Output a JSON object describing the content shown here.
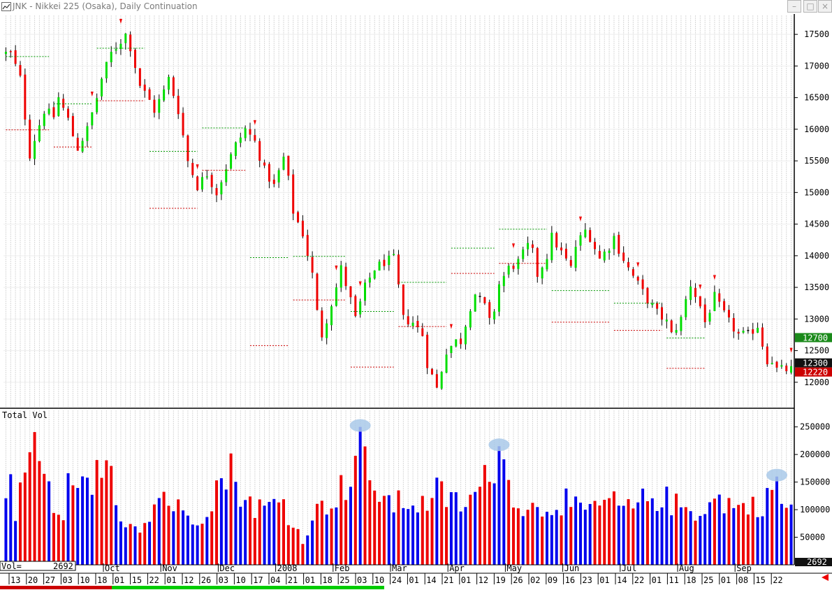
{
  "window": {
    "title": "JNK - Nikkei 225 (Osaka), Daily Continuation",
    "minimize_label": "–",
    "maximize_label": "□",
    "close_label": "×",
    "icon": "chart-window-icon"
  },
  "volume_panel": {
    "title": "Total Vol",
    "readout_label": "Vol=",
    "readout_value": "2692"
  },
  "price_badges": {
    "green": "12700",
    "black": "12300",
    "red": "12220"
  },
  "colors": {
    "up": "#00dd00",
    "down": "#ee0000",
    "neutral": "#000000",
    "vol_up": "#0000ee",
    "vol_down": "#ee0000",
    "grid": "#d8d8d8",
    "highlight": "#a9c9e9"
  },
  "chart_data": [
    {
      "type": "candlestick",
      "title": "JNK - Nikkei 225 (Osaka), Daily Continuation",
      "ylim": [
        11600,
        17800
      ],
      "y_ticks": [
        12000,
        12500,
        13000,
        13500,
        14000,
        14500,
        15000,
        15500,
        16000,
        16500,
        17000,
        17500
      ],
      "month_labels": [
        "Oct",
        "Nov",
        "Dec",
        "2008",
        "Feb",
        "Mar",
        "Apr",
        "May",
        "Jun",
        "Jul",
        "Aug",
        "Sep"
      ],
      "date_axis": [
        "13",
        "20",
        "27",
        "03",
        "10",
        "18",
        "01",
        "15",
        "22",
        "01",
        "12",
        "26",
        "03",
        "10",
        "17",
        "04",
        "21",
        "01",
        "18",
        "25",
        "03",
        "10",
        "24",
        "01",
        "14",
        "21",
        "01",
        "12",
        "19",
        "26",
        "02",
        "09",
        "16",
        "23",
        "01",
        "14",
        "22",
        "01",
        "11",
        "18",
        "25",
        "01",
        "08",
        "15",
        "22"
      ],
      "path": [
        [
          17200,
          1
        ],
        [
          16800,
          3
        ],
        [
          15600,
          5
        ],
        [
          15850,
          6
        ],
        [
          16300,
          8
        ],
        [
          16200,
          10
        ],
        [
          16500,
          11
        ],
        [
          16150,
          13
        ],
        [
          15900,
          14
        ],
        [
          15700,
          15
        ],
        [
          16000,
          17
        ],
        [
          16500,
          19
        ],
        [
          16800,
          20
        ],
        [
          17200,
          22
        ],
        [
          17500,
          25
        ],
        [
          17300,
          26
        ],
        [
          17000,
          27
        ],
        [
          16700,
          28
        ],
        [
          16450,
          30
        ],
        [
          16300,
          31
        ],
        [
          16600,
          33
        ],
        [
          16800,
          34
        ],
        [
          16300,
          36
        ],
        [
          15900,
          37
        ],
        [
          15500,
          38
        ],
        [
          15100,
          40
        ],
        [
          15300,
          42
        ],
        [
          15000,
          44
        ],
        [
          15400,
          46
        ],
        [
          15750,
          48
        ],
        [
          16000,
          50
        ],
        [
          15800,
          52
        ],
        [
          15350,
          54
        ],
        [
          15100,
          56
        ],
        [
          15550,
          58
        ],
        [
          15200,
          59
        ],
        [
          14700,
          60
        ],
        [
          14350,
          62
        ],
        [
          13700,
          64
        ],
        [
          13100,
          65
        ],
        [
          12750,
          66
        ],
        [
          13250,
          68
        ],
        [
          13500,
          69
        ],
        [
          13800,
          70
        ],
        [
          13300,
          72
        ],
        [
          13000,
          73
        ],
        [
          13500,
          75
        ],
        [
          13800,
          77
        ],
        [
          13900,
          79
        ],
        [
          13950,
          81
        ],
        [
          13500,
          82
        ],
        [
          13000,
          83
        ],
        [
          12950,
          85
        ],
        [
          12750,
          87
        ],
        [
          12300,
          88
        ],
        [
          11900,
          90
        ],
        [
          12200,
          91
        ],
        [
          12500,
          92
        ],
        [
          12650,
          94
        ],
        [
          12650,
          95
        ],
        [
          13200,
          97
        ],
        [
          13400,
          98
        ],
        [
          13200,
          100
        ],
        [
          12950,
          101
        ],
        [
          13150,
          102
        ],
        [
          13550,
          103
        ],
        [
          13800,
          105
        ],
        [
          13900,
          107
        ],
        [
          14150,
          109
        ],
        [
          14050,
          110
        ],
        [
          13700,
          111
        ],
        [
          14000,
          113
        ],
        [
          14300,
          114
        ],
        [
          14050,
          116
        ],
        [
          13800,
          118
        ],
        [
          14150,
          119
        ],
        [
          14400,
          121
        ],
        [
          14300,
          122
        ],
        [
          13950,
          124
        ],
        [
          14150,
          126
        ],
        [
          14300,
          127
        ],
        [
          14100,
          128
        ],
        [
          13800,
          130
        ],
        [
          13550,
          132
        ],
        [
          13300,
          134
        ],
        [
          13100,
          136
        ],
        [
          12950,
          138
        ],
        [
          12750,
          139
        ],
        [
          13000,
          141
        ],
        [
          13300,
          142
        ],
        [
          13550,
          143
        ],
        [
          13200,
          145
        ],
        [
          12950,
          146
        ],
        [
          13350,
          148
        ],
        [
          13200,
          149
        ],
        [
          12950,
          151
        ],
        [
          12750,
          153
        ],
        [
          12750,
          155
        ],
        [
          12900,
          157
        ],
        [
          12600,
          158
        ],
        [
          12350,
          159
        ],
        [
          12350,
          160
        ],
        [
          12200,
          161
        ]
      ],
      "resistance_levels": [
        {
          "price": 17150,
          "i0": 0,
          "i1": 9
        },
        {
          "price": 16400,
          "i0": 10,
          "i1": 18
        },
        {
          "price": 17280,
          "i0": 19,
          "i1": 29
        },
        {
          "price": 15650,
          "i0": 30,
          "i1": 40
        },
        {
          "price": 16020,
          "i0": 41,
          "i1": 50
        },
        {
          "price": 13970,
          "i0": 51,
          "i1": 59
        },
        {
          "price": 13990,
          "i0": 60,
          "i1": 71
        },
        {
          "price": 13120,
          "i0": 72,
          "i1": 81
        },
        {
          "price": 13580,
          "i0": 82,
          "i1": 92
        },
        {
          "price": 14120,
          "i0": 93,
          "i1": 102
        },
        {
          "price": 14420,
          "i0": 103,
          "i1": 113
        },
        {
          "price": 13450,
          "i0": 114,
          "i1": 126
        },
        {
          "price": 13250,
          "i0": 127,
          "i1": 137
        },
        {
          "price": 12700,
          "i0": 138,
          "i1": 146
        }
      ],
      "support_levels": [
        {
          "price": 15990,
          "i0": 0,
          "i1": 9
        },
        {
          "price": 15720,
          "i0": 10,
          "i1": 18
        },
        {
          "price": 16450,
          "i0": 19,
          "i1": 29
        },
        {
          "price": 14750,
          "i0": 30,
          "i1": 40
        },
        {
          "price": 15350,
          "i0": 41,
          "i1": 50
        },
        {
          "price": 12580,
          "i0": 51,
          "i1": 59
        },
        {
          "price": 13300,
          "i0": 60,
          "i1": 71
        },
        {
          "price": 12240,
          "i0": 72,
          "i1": 81
        },
        {
          "price": 12880,
          "i0": 82,
          "i1": 92
        },
        {
          "price": 13720,
          "i0": 93,
          "i1": 102
        },
        {
          "price": 13880,
          "i0": 103,
          "i1": 113
        },
        {
          "price": 12950,
          "i0": 114,
          "i1": 126
        },
        {
          "price": 12820,
          "i0": 127,
          "i1": 137
        },
        {
          "price": 12220,
          "i0": 138,
          "i1": 146
        }
      ],
      "fractal_markers": [
        18,
        24,
        40,
        52,
        69,
        74,
        93,
        106,
        120,
        132,
        145,
        148,
        164
      ]
    },
    {
      "type": "bar",
      "title": "Total Vol",
      "ylim": [
        0,
        280000
      ],
      "y_ticks": [
        50000,
        100000,
        150000,
        200000,
        250000
      ],
      "volume_path": [
        [
          105000,
          0
        ],
        [
          165000,
          1
        ],
        [
          80000,
          2
        ],
        [
          130000,
          3
        ],
        [
          260000,
          5
        ],
        [
          175000,
          7
        ],
        [
          140000,
          9
        ],
        [
          80000,
          10
        ],
        [
          95000,
          12
        ],
        [
          140000,
          13
        ],
        [
          120000,
          15
        ],
        [
          160000,
          17
        ],
        [
          120000,
          18
        ],
        [
          210000,
          20
        ],
        [
          180000,
          22
        ],
        [
          90000,
          24
        ],
        [
          75000,
          27
        ],
        [
          80000,
          30
        ],
        [
          140000,
          32
        ],
        [
          110000,
          35
        ],
        [
          90000,
          38
        ],
        [
          95000,
          41
        ],
        [
          145000,
          44
        ],
        [
          175000,
          47
        ],
        [
          120000,
          50
        ],
        [
          105000,
          53
        ],
        [
          110000,
          56
        ],
        [
          120000,
          58
        ],
        [
          70000,
          60
        ],
        [
          50000,
          62
        ],
        [
          85000,
          64
        ],
        [
          110000,
          66
        ],
        [
          130000,
          69
        ],
        [
          160000,
          72
        ],
        [
          250000,
          74
        ],
        [
          130000,
          76
        ],
        [
          140000,
          78
        ],
        [
          110000,
          81
        ],
        [
          120000,
          84
        ],
        [
          110000,
          87
        ],
        [
          135000,
          90
        ],
        [
          120000,
          93
        ],
        [
          110000,
          96
        ],
        [
          140000,
          99
        ],
        [
          170000,
          101
        ],
        [
          215000,
          103
        ],
        [
          150000,
          105
        ],
        [
          110000,
          108
        ],
        [
          100000,
          111
        ],
        [
          115000,
          114
        ],
        [
          120000,
          117
        ],
        [
          95000,
          120
        ],
        [
          105000,
          123
        ],
        [
          120000,
          126
        ],
        [
          100000,
          129
        ],
        [
          110000,
          132
        ],
        [
          130000,
          135
        ],
        [
          120000,
          138
        ],
        [
          105000,
          141
        ],
        [
          100000,
          144
        ],
        [
          115000,
          147
        ],
        [
          120000,
          150
        ],
        [
          105000,
          153
        ],
        [
          110000,
          156
        ],
        [
          120000,
          159
        ],
        [
          160000,
          161
        ],
        [
          105000,
          162
        ]
      ],
      "highlights": [
        74,
        103,
        161
      ]
    }
  ]
}
